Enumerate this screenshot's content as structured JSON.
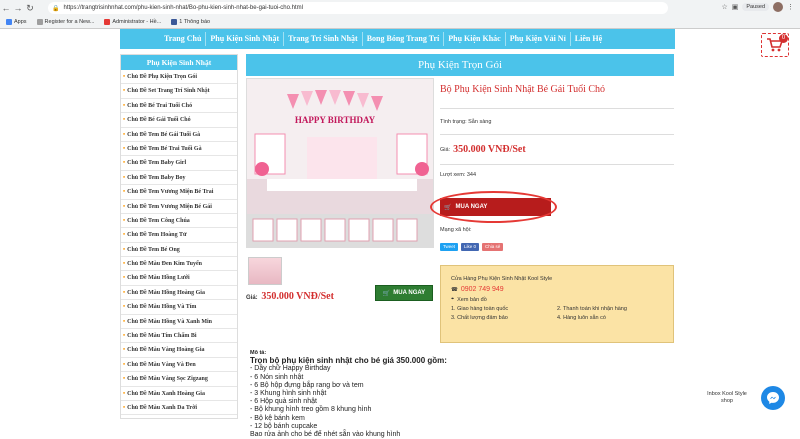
{
  "browser": {
    "url": "https://trangtrisinhnhat.com/phu-kien-sinh-nhat/Bo-phu-kien-sinh-nhat-be-gai-tuoi-cho.html",
    "paused_label": "Paused",
    "bookmarks": [
      "Apps",
      "Register for a New...",
      "Administrator - Hề...",
      "1 Thông báo"
    ]
  },
  "nav": [
    "Trang Chủ",
    "Phụ Kiện Sinh Nhật",
    "Trang Trí Sinh Nhật",
    "Bong Bóng Trang Trí",
    "Phụ Kiện Khác",
    "Phụ Kiện Vải Nỉ",
    "Liên Hệ"
  ],
  "cart_count": "0",
  "sidebar": {
    "title": "Phụ Kiện Sinh Nhật",
    "items": [
      "Chủ Đề Phụ Kiện Trọn Gói",
      "Chủ Đề Set Trang Trí Sinh Nhật",
      "Chủ Đề Bé Trai Tuổi Chó",
      "Chủ Đề Bé Gái Tuổi Chó",
      "Chủ Đề Tem Bé Gái Tuổi Gà",
      "Chủ Đề Tem Bé Trai Tuổi Gà",
      "Chủ Đề Tem Baby Girl",
      "Chủ Đề Tem Baby Boy",
      "Chủ Đề Tem Vương Miện Bé Trai",
      "Chủ Đề Tem Vương Miện Bé Gái",
      "Chủ Đề Tem Công Chúa",
      "Chủ Đề Tem Hoàng Tử",
      "Chủ Đề Tem Bé Ong",
      "Chủ Đề Màu Đen Kim Tuyến",
      "Chủ Đề Màu Hồng Lưới",
      "Chủ Đề Màu Hồng Hoàng Gia",
      "Chủ Đề Màu Hồng Và Tím",
      "Chủ Đề Màu Hồng Và Xanh Min",
      "Chủ Đề Màu Tím Chấm Bi",
      "Chủ Đề Màu Vàng Hoàng Gia",
      "Chủ Đề Màu Vàng Và Đen",
      "Chủ Đề Màu Vàng Sọc Zigzang",
      "Chủ Đề Màu Xanh Hoàng Gia",
      "Chủ Đề Màu Xanh Da Trời"
    ]
  },
  "main_title": "Phụ Kiện Trọn Gói",
  "photo_banner": "HAPPY BIRTHDAY",
  "product": {
    "title": "Bộ Phụ Kiện Sinh Nhật Bé Gái Tuổi Chó",
    "status_label": "Tình trạng:",
    "status_value": "Sẵn sàng",
    "price_label": "Giá:",
    "price": "350.000 VNĐ/Set",
    "views_label": "Lượt xem:",
    "views": "344",
    "buy_label": "MUA NGAY",
    "share_label": "Mạng xã hội:",
    "share_buttons": [
      "Tweet",
      "Like 0",
      "Chia sẻ"
    ]
  },
  "left_price": {
    "label": "Giá:",
    "value": "350.000 VNĐ/Set",
    "buy_label": "MUA NGAY"
  },
  "store": {
    "title": "Cửa Hàng Phụ Kiện Sinh Nhật Kool Style",
    "phone": "0902 749 949",
    "map_label": "Xem bản đồ",
    "features": [
      "1. Giao hàng toàn quốc",
      "2. Thanh toán khi nhận hàng",
      "3. Chất lượng đảm bảo",
      "4. Hàng luôn sẵn có"
    ]
  },
  "description": {
    "label": "Mô tả:",
    "headline": "Trọn bộ phụ kiện sinh nhật cho bé giá 350.000 gồm:",
    "items": [
      "- Dây chữ Happy Birthday",
      "- 6 Nón sinh nhật",
      "- 6 Bộ hộp đựng bắp rang bơ và tem",
      "- 3 Khung hình sinh nhật",
      "- 6 Hộp quà sinh nhật",
      "- Bộ khung hình treo gồm 8 khung hình",
      "- Bộ kệ bánh kem",
      "- 12 bộ bánh cupcake",
      "Bao rửa ảnh cho bé để nhét sẵn vào khung hình"
    ]
  },
  "chat": {
    "label": "Inbox Kool Style shop"
  }
}
